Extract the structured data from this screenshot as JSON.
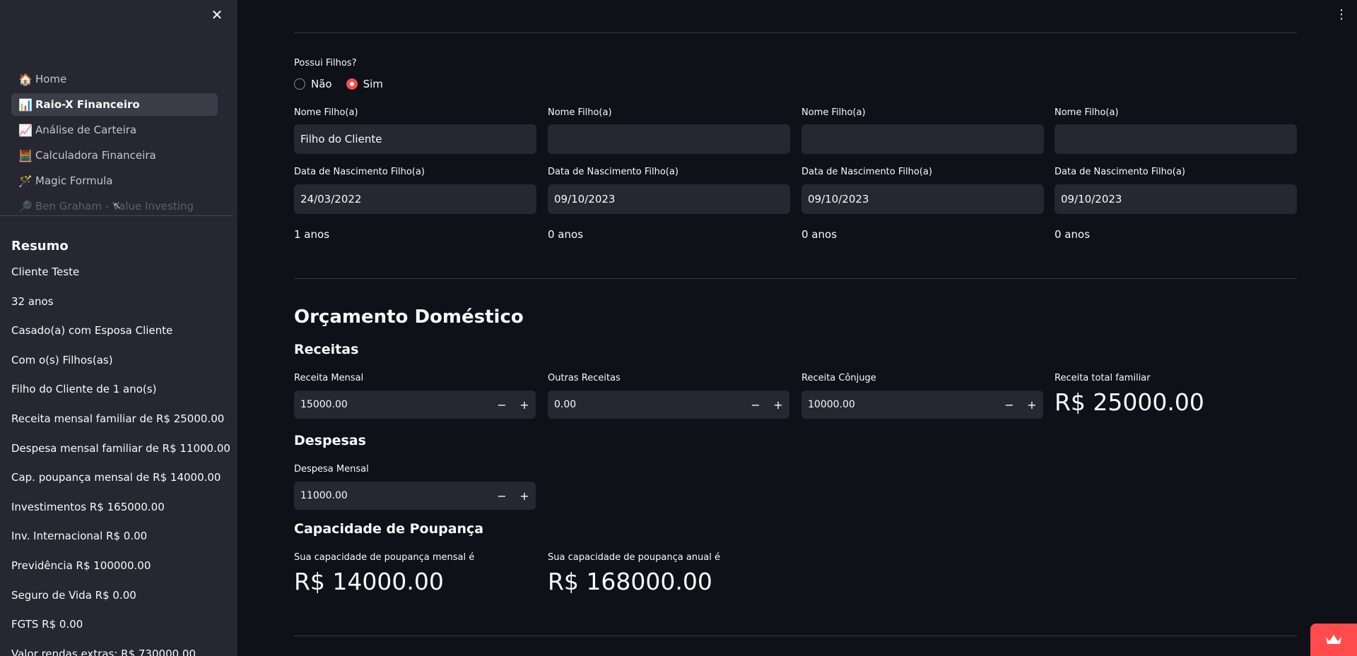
{
  "sidebar": {
    "nav": [
      {
        "emoji": "🏠",
        "label": "Home"
      },
      {
        "emoji": "📊",
        "label": "Raio-X Financeiro"
      },
      {
        "emoji": "📈",
        "label": "Análise de Carteira"
      },
      {
        "emoji": "🧮",
        "label": "Calculadora Financeira"
      },
      {
        "emoji": "🪄",
        "label": "Magic Formula"
      },
      {
        "emoji": "🔎",
        "label": "Ben Graham - Value Investing"
      }
    ],
    "summary_title": "Resumo",
    "summary": [
      "Cliente Teste",
      "32 anos",
      "Casado(a) com Esposa Cliente",
      "Com o(s) Filhos(as)",
      "Filho do Cliente de 1 ano(s)",
      "Receita mensal familiar de R$ 25000.00",
      "Despesa mensal familiar de R$ 11000.00",
      "Cap. poupança mensal de R$ 14000.00",
      "Investimentos R$ 165000.00",
      "Inv. Internacional R$ 0.00",
      "Previdência R$ 100000.00",
      "Seguro de Vida R$ 0.00",
      "FGTS R$ 0.00",
      "Valor rendas extras: R$ 730000.00"
    ]
  },
  "children": {
    "question": "Possui Filhos?",
    "options": [
      "Não",
      "Sim"
    ],
    "selected": "Sim",
    "name_label": "Nome Filho(a)",
    "birth_label": "Data de Nascimento Filho(a)",
    "items": [
      {
        "name": "Filho do Cliente",
        "birth": "24/03/2022",
        "age": "1 anos"
      },
      {
        "name": "",
        "birth": "09/10/2023",
        "age": "0 anos"
      },
      {
        "name": "",
        "birth": "09/10/2023",
        "age": "0 anos"
      },
      {
        "name": "",
        "birth": "09/10/2023",
        "age": "0 anos"
      }
    ]
  },
  "budget": {
    "title": "Orçamento Doméstico",
    "income_title": "Receitas",
    "monthly_income_label": "Receita Mensal",
    "monthly_income": "15000.00",
    "other_income_label": "Outras Receitas",
    "other_income": "0.00",
    "spouse_income_label": "Receita Cônjuge",
    "spouse_income": "10000.00",
    "total_income_label": "Receita total familiar",
    "total_income": "R$ 25000.00",
    "expense_title": "Despesas",
    "monthly_expense_label": "Despesa Mensal",
    "monthly_expense": "11000.00",
    "savings_title": "Capacidade de Poupança",
    "savings_monthly_label": "Sua capacidade de poupança mensal é",
    "savings_monthly": "R$ 14000.00",
    "savings_annual_label": "Sua capacidade de poupança anual é",
    "savings_annual": "R$ 168000.00"
  },
  "stepper": {
    "minus": "−",
    "plus": "+"
  },
  "icons": {
    "close": "close-icon",
    "menu": "kebab-menu-icon",
    "crown": "crown-icon"
  },
  "colors": {
    "accent": "#ff4b4b",
    "background": "#0e1117",
    "sidebar": "#262730"
  }
}
